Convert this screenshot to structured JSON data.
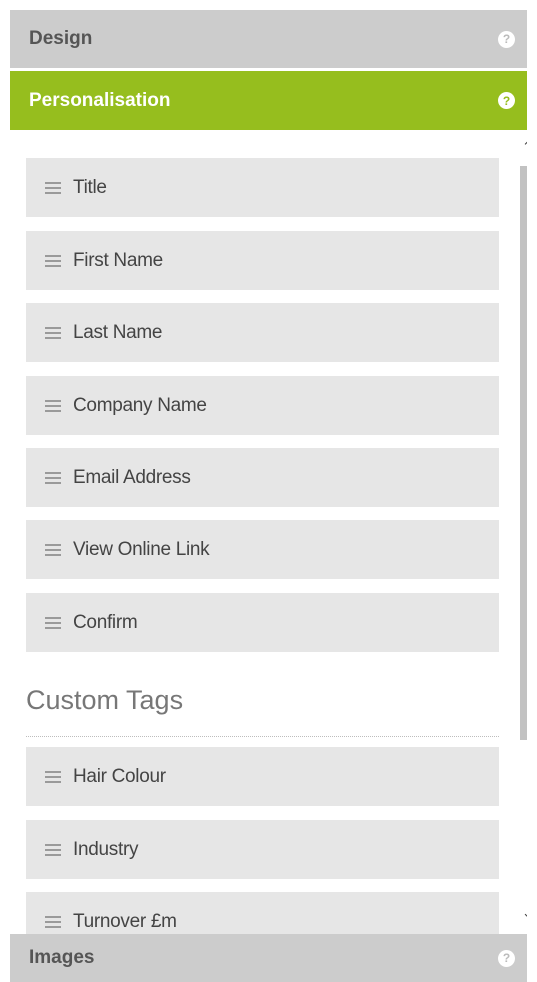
{
  "accordion": {
    "design": {
      "label": "Design",
      "help": "?"
    },
    "personalisation": {
      "label": "Personalisation",
      "help": "?"
    },
    "images": {
      "label": "Images",
      "help": "?"
    }
  },
  "standard_tags": [
    "Title",
    "First Name",
    "Last Name",
    "Company Name",
    "Email Address",
    "View Online Link",
    "Confirm"
  ],
  "custom_section": {
    "title": "Custom Tags"
  },
  "custom_tags": [
    "Hair Colour",
    "Industry",
    "Turnover £m"
  ],
  "scrollbar": {
    "up": "⌃",
    "down": "⌄"
  },
  "colors": {
    "accent": "#96be1e",
    "header_gray": "#cccccc",
    "item_bg": "#e6e6e6"
  }
}
